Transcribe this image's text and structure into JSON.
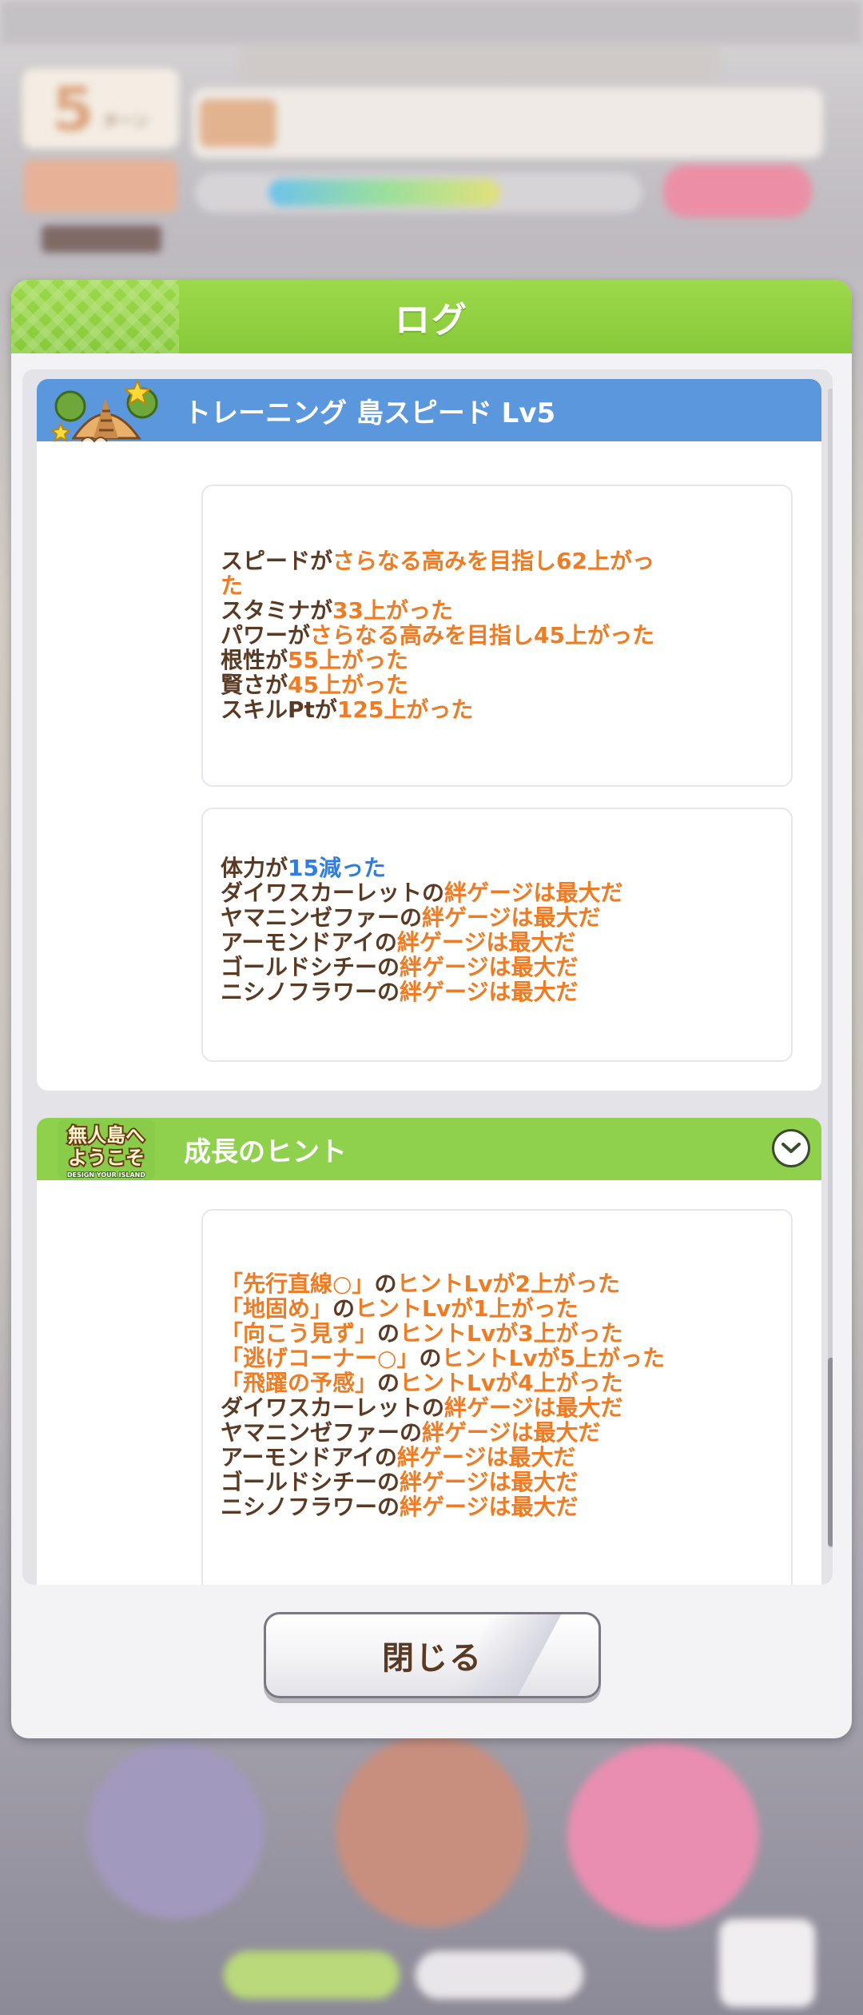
{
  "background": {
    "turn_number": "5",
    "turn_suffix": "ターン"
  },
  "dialog": {
    "title": "ログ",
    "close_label": "閉じる"
  },
  "cards": [
    {
      "icon": "training-island-icon",
      "header_color": "#5b97dc",
      "title": "トレーニング 島スピード Lv5",
      "boxes": [
        [
          [
            [
              "スピードが",
              ""
            ],
            [
              "さらなる高みを目指し62上がっ",
              "o"
            ]
          ],
          [
            [
              "た",
              "o"
            ]
          ],
          [
            [
              "スタミナが",
              ""
            ],
            [
              "33上がった",
              "o"
            ]
          ],
          [
            [
              "パワーが",
              ""
            ],
            [
              "さらなる高みを目指し45上がった",
              "o"
            ]
          ],
          [
            [
              "根性が",
              ""
            ],
            [
              "55上がった",
              "o"
            ]
          ],
          [
            [
              "賢さが",
              ""
            ],
            [
              "45上がった",
              "o"
            ]
          ],
          [
            [
              "スキルPtが",
              ""
            ],
            [
              "125上がった",
              "o"
            ]
          ]
        ],
        [
          [
            [
              "体力が",
              ""
            ],
            [
              "15減った",
              "b"
            ]
          ],
          [
            [
              "ダイワスカーレットの",
              ""
            ],
            [
              "絆ゲージは最大だ",
              "o"
            ]
          ],
          [
            [
              "ヤマニンゼファーの",
              ""
            ],
            [
              "絆ゲージは最大だ",
              "o"
            ]
          ],
          [
            [
              "アーモンドアイの",
              ""
            ],
            [
              "絆ゲージは最大だ",
              "o"
            ]
          ],
          [
            [
              "ゴールドシチーの",
              ""
            ],
            [
              "絆ゲージは最大だ",
              "o"
            ]
          ],
          [
            [
              "ニシノフラワーの",
              ""
            ],
            [
              "絆ゲージは最大だ",
              "o"
            ]
          ]
        ]
      ]
    },
    {
      "icon": "welcome-island-logo-icon",
      "logo_text_1": "無人島へ",
      "logo_text_2": "ようこそ",
      "logo_sub": "DESIGN YOUR ISLAND",
      "header_color": "#8fd14d",
      "title": "成長のヒント",
      "boxes": [
        [
          [
            [
              "「先行直線○」",
              "o"
            ],
            [
              "の",
              ""
            ],
            [
              "ヒントLvが2上がった",
              "o"
            ]
          ],
          [
            [
              "「地固め」",
              "o"
            ],
            [
              "の",
              ""
            ],
            [
              "ヒントLvが1上がった",
              "o"
            ]
          ],
          [
            [
              "「向こう見ず」",
              "o"
            ],
            [
              "の",
              ""
            ],
            [
              "ヒントLvが3上がった",
              "o"
            ]
          ],
          [
            [
              "「逃げコーナー○」",
              "o"
            ],
            [
              "の",
              ""
            ],
            [
              "ヒントLvが5上がった",
              "o"
            ]
          ],
          [
            [
              "「飛躍の予感」",
              "o"
            ],
            [
              "の",
              ""
            ],
            [
              "ヒントLvが4上がった",
              "o"
            ]
          ],
          [
            [
              "ダイワスカーレットの",
              ""
            ],
            [
              "絆ゲージは最大だ",
              "o"
            ]
          ],
          [
            [
              "ヤマニンゼファーの",
              ""
            ],
            [
              "絆ゲージは最大だ",
              "o"
            ]
          ],
          [
            [
              "アーモンドアイの",
              ""
            ],
            [
              "絆ゲージは最大だ",
              "o"
            ]
          ],
          [
            [
              "ゴールドシチーの",
              ""
            ],
            [
              "絆ゲージは最大だ",
              "o"
            ]
          ],
          [
            [
              "ニシノフラワーの",
              ""
            ],
            [
              "絆ゲージは最大だ",
              "o"
            ]
          ]
        ]
      ]
    }
  ]
}
